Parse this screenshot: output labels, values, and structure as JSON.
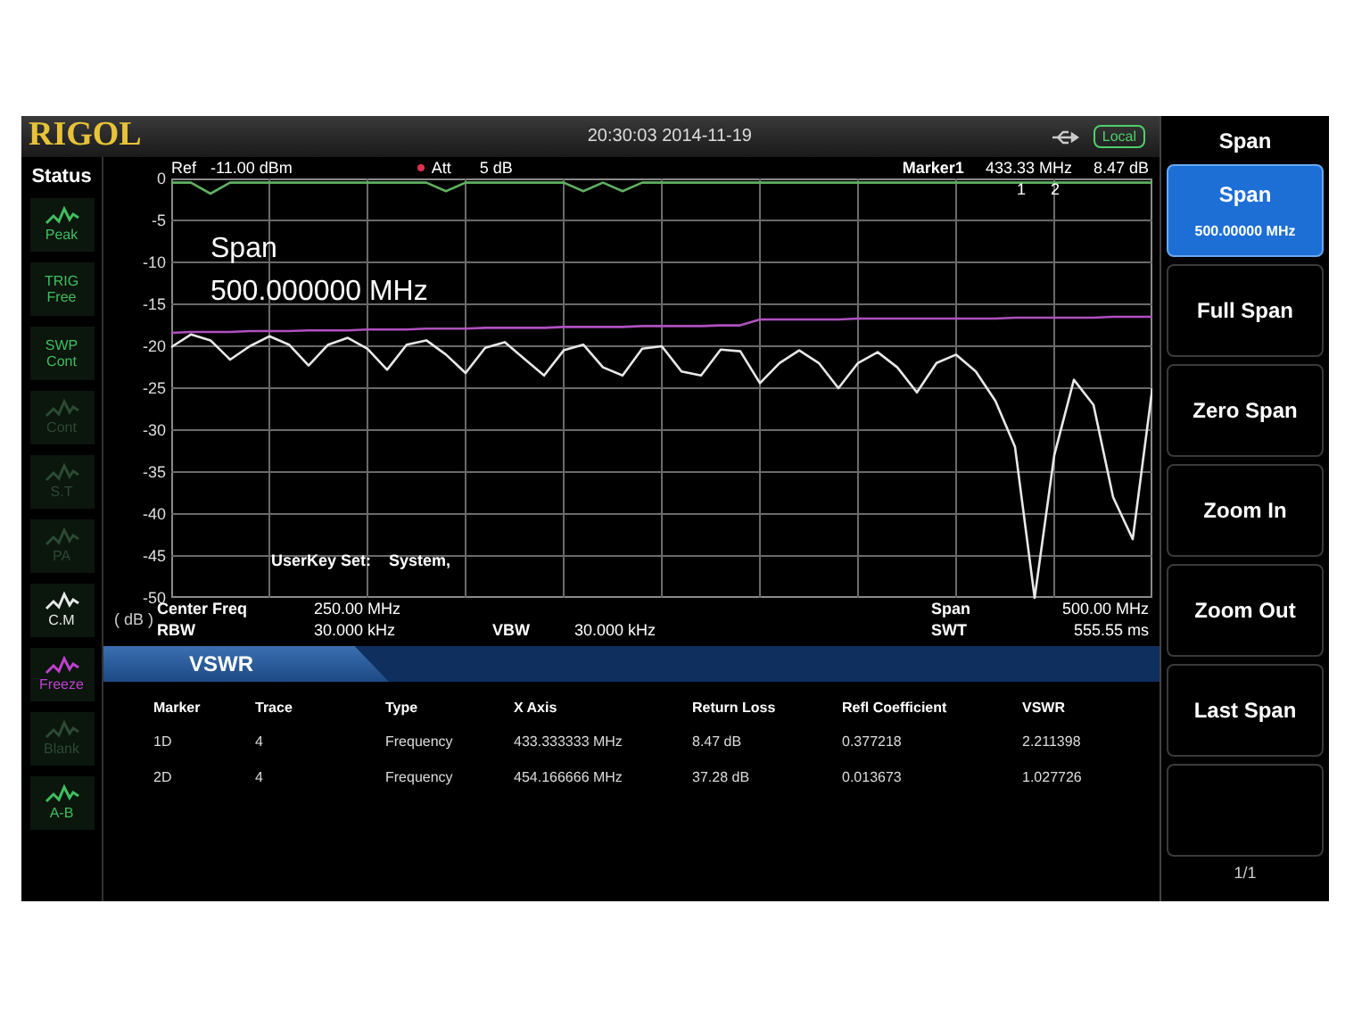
{
  "header": {
    "logo": "RIGOL",
    "datetime": "20:30:03 2014-11-19",
    "remote_badge": "Local"
  },
  "status": {
    "title": "Status",
    "items": [
      {
        "kind": "icon",
        "label": "Peak",
        "color": "#3fbf5f"
      },
      {
        "kind": "text",
        "top": "TRIG",
        "label": "Free",
        "color": "#3fbf5f"
      },
      {
        "kind": "text",
        "top": "SWP",
        "label": "Cont",
        "color": "#3fbf5f"
      },
      {
        "kind": "icon",
        "label": "Cont",
        "color": "#2c4a33"
      },
      {
        "kind": "icon",
        "label": "S.T",
        "color": "#2c4a33"
      },
      {
        "kind": "icon",
        "label": "PA",
        "color": "#2c4a33"
      },
      {
        "kind": "icon",
        "label": "C.M",
        "color": "#e8e8e8"
      },
      {
        "kind": "icon",
        "label": "Freeze",
        "color": "#c040d0"
      },
      {
        "kind": "icon",
        "label": "Blank",
        "color": "#2c4a33"
      },
      {
        "kind": "icon",
        "label": "A-B",
        "color": "#3fbf5f"
      }
    ]
  },
  "plot": {
    "ref_label": "Ref",
    "ref_value": "-11.00 dBm",
    "att_label": "Att",
    "att_value": "5 dB",
    "marker_label": "Marker1",
    "marker_freq": "433.33 MHz",
    "marker_value": "8.47 dB",
    "marker_numbers": [
      "1",
      "2"
    ],
    "chart_data": {
      "type": "line",
      "grid": true,
      "ylim": [
        -50,
        0
      ],
      "yticks": [
        0,
        -5,
        -10,
        -15,
        -20,
        -25,
        -30,
        -35,
        -40,
        -45,
        -50
      ],
      "categories": [
        null,
        null,
        null,
        null,
        null,
        null,
        null,
        null,
        null,
        null,
        null,
        null,
        null,
        null,
        null,
        null,
        null,
        null,
        null,
        null,
        null,
        null,
        null,
        null,
        null,
        null,
        null,
        null,
        null,
        null,
        null,
        null,
        null,
        null,
        null,
        null,
        null,
        null,
        null,
        null,
        null,
        null,
        null,
        null,
        null,
        null,
        null,
        null,
        null,
        null,
        null
      ],
      "series": [
        {
          "color": "#5fb060",
          "values": [
            -0.5,
            -0.5,
            -1.8,
            -0.5,
            -0.5,
            -0.5,
            -0.5,
            -0.5,
            -0.5,
            -0.5,
            -0.5,
            -0.5,
            -0.5,
            -0.5,
            -1.5,
            -0.5,
            -0.5,
            -0.5,
            -0.5,
            -0.5,
            -0.5,
            -1.5,
            -0.5,
            -1.5,
            -0.5,
            -0.5,
            -0.5,
            -0.5,
            -0.5,
            -0.5,
            -0.5,
            -0.5,
            -0.5,
            -0.5,
            -0.5,
            -0.5,
            -0.5,
            -0.5,
            -0.5,
            -0.5,
            -0.5,
            -0.5,
            -0.5,
            -0.5,
            -0.5,
            -0.5,
            -0.5,
            -0.5,
            -0.5,
            -0.5,
            -0.5
          ]
        },
        {
          "color": "#b050c0",
          "values": [
            -18.4,
            -18.3,
            -18.3,
            -18.3,
            -18.2,
            -18.2,
            -18.2,
            -18.1,
            -18.1,
            -18.1,
            -18.0,
            -18.0,
            -18.0,
            -17.9,
            -17.9,
            -17.9,
            -17.8,
            -17.8,
            -17.8,
            -17.8,
            -17.7,
            -17.7,
            -17.7,
            -17.7,
            -17.6,
            -17.6,
            -17.6,
            -17.6,
            -17.5,
            -17.5,
            -16.8,
            -16.8,
            -16.8,
            -16.8,
            -16.8,
            -16.7,
            -16.7,
            -16.7,
            -16.7,
            -16.7,
            -16.7,
            -16.7,
            -16.7,
            -16.6,
            -16.6,
            -16.6,
            -16.6,
            -16.6,
            -16.5,
            -16.5,
            -16.5
          ]
        },
        {
          "color": "#e8e8e8",
          "values": [
            -20.1,
            -18.6,
            -19.3,
            -21.6,
            -20.0,
            -18.8,
            -19.8,
            -22.3,
            -19.8,
            -19.0,
            -20.3,
            -22.8,
            -19.8,
            -19.3,
            -21.0,
            -23.2,
            -20.2,
            -19.5,
            -21.5,
            -23.5,
            -20.5,
            -19.8,
            -22.5,
            -23.5,
            -20.3,
            -20.0,
            -23.0,
            -23.5,
            -20.4,
            -20.6,
            -24.4,
            -22.0,
            -20.5,
            -22.0,
            -25.0,
            -22.0,
            -20.7,
            -22.5,
            -25.5,
            -22.0,
            -21.0,
            -23.0,
            -26.5,
            -32.0,
            -50.0,
            -33.0,
            -24.0,
            -27.0,
            -38.0,
            -43.0,
            -25.0
          ]
        }
      ]
    },
    "unit": "( dB )",
    "overlay_title": "Span",
    "overlay_value": "500.000000 MHz",
    "userkey_label": "UserKey Set:",
    "userkey_value": "System,"
  },
  "settings": {
    "center_label": "Center Freq",
    "center_value": "250.00 MHz",
    "span_label": "Span",
    "span_value": "500.00 MHz",
    "rbw_label": "RBW",
    "rbw_value": "30.000 kHz",
    "vbw_label": "VBW",
    "vbw_value": "30.000 kHz",
    "swt_label": "SWT",
    "swt_value": "555.55 ms"
  },
  "vswr": {
    "title": "VSWR",
    "columns": [
      "Marker",
      "Trace",
      "Type",
      "X Axis",
      "Return Loss",
      "Refl Coefficient",
      "VSWR"
    ],
    "rows": [
      [
        "1D",
        "4",
        "Frequency",
        "433.333333 MHz",
        "8.47 dB",
        "0.377218",
        "2.211398"
      ],
      [
        "2D",
        "4",
        "Frequency",
        "454.166666 MHz",
        "37.28 dB",
        "0.013673",
        "1.027726"
      ]
    ]
  },
  "menu": {
    "title": "Span",
    "items": [
      {
        "label": "Span",
        "value": "500.00000 MHz",
        "selected": true
      },
      {
        "label": "Full Span",
        "selected": false
      },
      {
        "label": "Zero Span",
        "selected": false
      },
      {
        "label": "Zoom In",
        "selected": false
      },
      {
        "label": "Zoom Out",
        "selected": false
      },
      {
        "label": "Last Span",
        "selected": false
      }
    ],
    "page": "1/1"
  }
}
